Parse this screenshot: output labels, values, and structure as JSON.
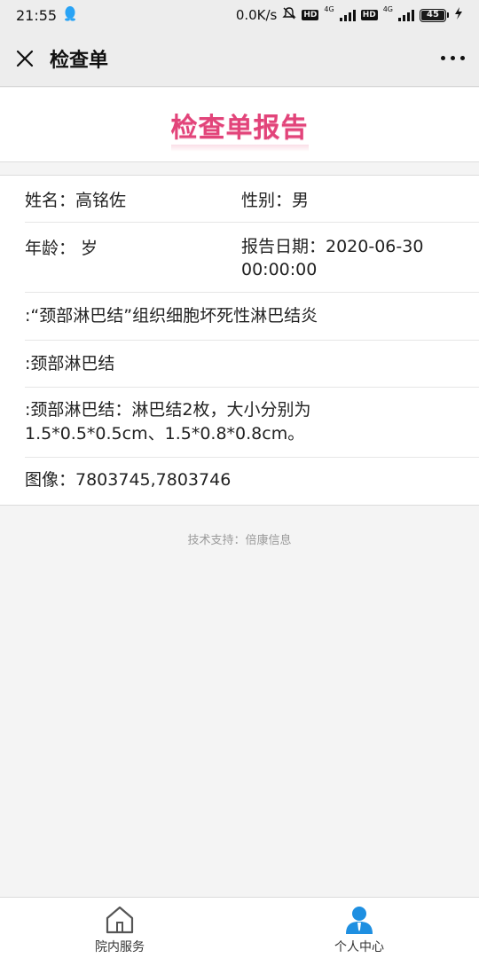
{
  "status_bar": {
    "time": "21:55",
    "net_speed": "0.0K/s",
    "battery": "45",
    "hd1": "HD",
    "hd2": "HD",
    "net1": "4G",
    "net2": "4G",
    "qq_icon": "qq-penguin-icon"
  },
  "header": {
    "title": "检查单",
    "close_icon": "close-icon",
    "more_icon": "more-dots-icon"
  },
  "banner": {
    "title": "检查单报告",
    "color": "#e2447a"
  },
  "report": {
    "name_label": "姓名：高铭佐",
    "gender_label": "性别：男",
    "age_label": "年龄： 岁",
    "date_label": "报告日期：2020-06-30",
    "date_time": "00:00:00",
    "diagnosis": ":“颈部淋巴结”组织细胞坏死性淋巴结炎",
    "site": ":颈部淋巴结",
    "description_line1": ":颈部淋巴结：淋巴结2枚，大小分别为",
    "description_line2": "1.5*0.5*0.5cm、1.5*0.8*0.8cm。",
    "images": "图像：7803745,7803746"
  },
  "footer": {
    "support": "技术支持：倍康信息"
  },
  "tabbar": {
    "tabs": [
      {
        "label": "院内服务",
        "icon": "home-icon",
        "color": "#555555"
      },
      {
        "label": "个人中心",
        "icon": "user-icon",
        "color": "#1e8fe1"
      }
    ]
  }
}
